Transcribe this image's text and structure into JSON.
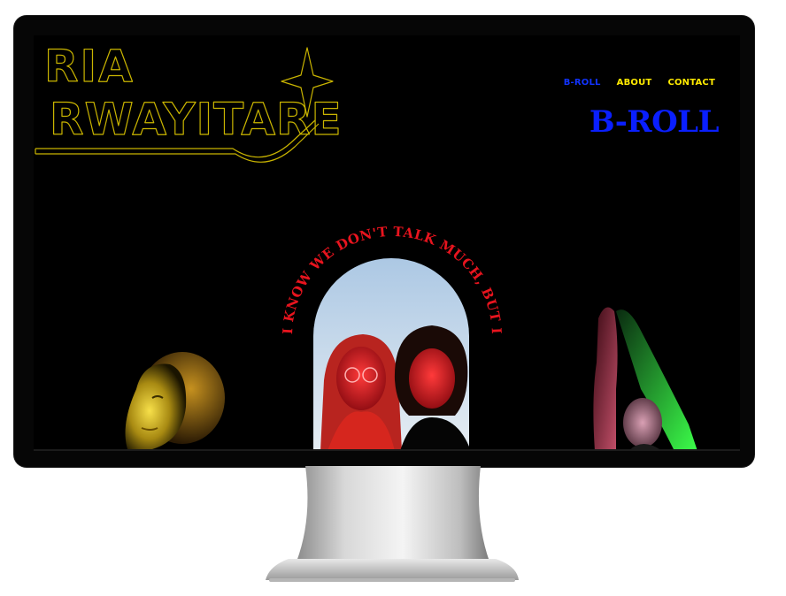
{
  "brand": {
    "line1": "RIA",
    "line2": "RWAYITARE",
    "logo_color": "#c9b400"
  },
  "nav": {
    "items": [
      {
        "label": "B-ROLL",
        "active": true
      },
      {
        "label": "ABOUT",
        "active": false
      },
      {
        "label": "CONTACT",
        "active": false
      }
    ]
  },
  "page": {
    "heading": "B-ROLL",
    "arc_caption": "I KNOW WE DON'T TALK MUCH, BUT I"
  },
  "colors": {
    "background": "#000000",
    "active_blue": "#1133ff",
    "nav_yellow": "#ffea00",
    "arc_red": "#e8141e"
  }
}
